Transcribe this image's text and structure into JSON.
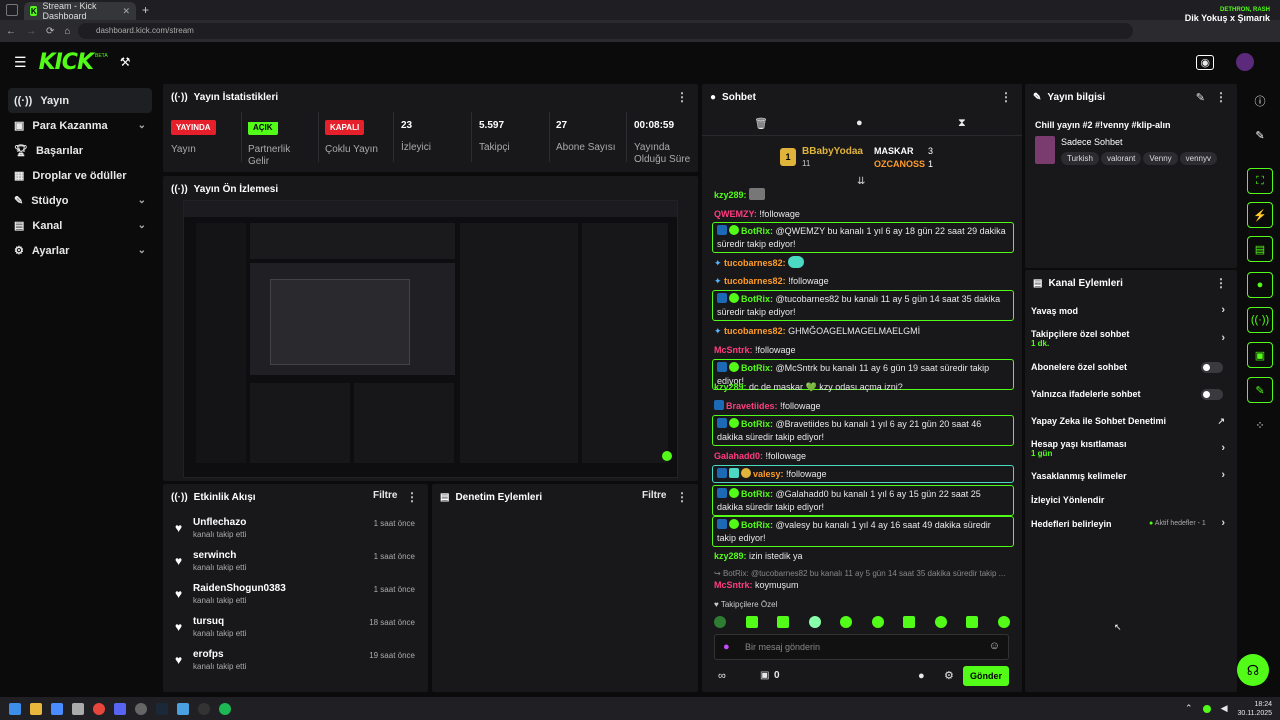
{
  "browser": {
    "tab_title": "Stream - Kick Dashboard",
    "new_tab": "+",
    "url": "dashboard.kick.com/stream",
    "now_playing_artist": "DETHRON, RASH",
    "now_playing_title": "Dik Yokuş x Şımarık"
  },
  "header": {
    "logo": "KICK",
    "beta": "BETA"
  },
  "sidebar": {
    "items": [
      {
        "label": "Yayın",
        "icon": "broadcast-icon",
        "active": true
      },
      {
        "label": "Para Kazanma",
        "icon": "money-icon",
        "chevron": true
      },
      {
        "label": "Başarılar",
        "icon": "trophy-icon"
      },
      {
        "label": "Droplar ve ödüller",
        "icon": "gift-icon"
      },
      {
        "label": "Stüdyo",
        "icon": "studio-icon",
        "chevron": true
      },
      {
        "label": "Kanal",
        "icon": "channel-icon",
        "chevron": true
      },
      {
        "label": "Ayarlar",
        "icon": "gear-icon",
        "chevron": true
      }
    ]
  },
  "stats": {
    "title": "Yayın İstatistikleri",
    "items": [
      {
        "value": "YAYINDA",
        "label": "Yayın",
        "type": "badge-red"
      },
      {
        "value": "AÇIK",
        "label": "Partnerlik Gelir Programı",
        "type": "badge-green"
      },
      {
        "value": "KAPALI",
        "label": "Çoklu Yayın",
        "type": "badge-red"
      },
      {
        "value": "23",
        "label": "İzleyici"
      },
      {
        "value": "5.597",
        "label": "Takipçi"
      },
      {
        "value": "27",
        "label": "Abone Sayısı"
      },
      {
        "value": "00:08:59",
        "label": "Yayında Olduğu Süre"
      }
    ]
  },
  "preview": {
    "title": "Yayın Ön İzlemesi"
  },
  "activity": {
    "title": "Etkinlik Akışı",
    "filter": "Filtre",
    "events": [
      {
        "name": "Unflechazo",
        "sub": "kanalı takip etti",
        "time": "1 saat önce"
      },
      {
        "name": "serwinch",
        "sub": "kanalı takip etti",
        "time": "1 saat önce"
      },
      {
        "name": "RaidenShogun0383",
        "sub": "kanalı takip etti",
        "time": "1 saat önce"
      },
      {
        "name": "tursuq",
        "sub": "kanalı takip etti",
        "time": "18 saat önce"
      },
      {
        "name": "erofps",
        "sub": "kanalı takip etti",
        "time": "19 saat önce"
      }
    ]
  },
  "moderation": {
    "title": "Denetim Eylemleri",
    "filter": "Filtre"
  },
  "chat": {
    "title": "Sohbet",
    "leaderboard": {
      "first": {
        "name": "BBabyYodaa",
        "count": "11"
      },
      "second": {
        "name": "MASKAR",
        "count": "3"
      },
      "third": {
        "name": "OZCANOSS",
        "count": "1"
      }
    },
    "messages": [
      {
        "user": "kzy289",
        "text": "",
        "color": "green",
        "type": "msg"
      },
      {
        "user": "QWEMZY",
        "text": "!followage",
        "color": "pink",
        "type": "msg"
      },
      {
        "user": "BotRix",
        "text": "@QWEMZY bu kanalı 1 yıl 6 ay 18 gün 22 saat 29 dakika süredir takip ediyor!",
        "type": "bot"
      },
      {
        "user": "tucobarnes82",
        "text": "",
        "color": "orange",
        "type": "msg"
      },
      {
        "user": "tucobarnes82",
        "text": "!followage",
        "color": "orange",
        "type": "msg"
      },
      {
        "user": "BotRix",
        "text": "@tucobarnes82 bu kanalı 11 ay 5 gün 14 saat 35 dakika süredir takip ediyor!",
        "type": "bot"
      },
      {
        "user": "tucobarnes82",
        "text": "GHMĞOAGELMAGELMAELGMİ",
        "color": "orange",
        "type": "msg"
      },
      {
        "user": "McSntrk",
        "text": "!followage",
        "color": "pink",
        "type": "msg"
      },
      {
        "user": "BotRix",
        "text": "@McSntrk bu kanalı 11 ay 6 gün 19 saat süredir takip ediyor!",
        "type": "bot"
      },
      {
        "user": "kzy289",
        "text": "dc de maskar 💚 kzy odası açma izni?",
        "color": "green",
        "type": "msg"
      },
      {
        "user": "Bravetiides",
        "text": "!followage",
        "color": "pink",
        "type": "msg"
      },
      {
        "user": "BotRix",
        "text": "@Bravetiides bu kanalı 1 yıl 6 ay 21 gün 20 saat 46 dakika süredir takip ediyor!",
        "type": "bot"
      },
      {
        "user": "Galahadd0",
        "text": "!followage",
        "color": "pink",
        "type": "msg"
      },
      {
        "user": "valesy",
        "text": "!followage",
        "color": "orange",
        "type": "highlight"
      },
      {
        "user": "BotRix",
        "text": "@Galahadd0 bu kanalı 1 yıl 6 ay 15 gün 22 saat 25 dakika süredir takip ediyor!",
        "type": "bot"
      },
      {
        "user": "BotRix",
        "text": "@valesy bu kanalı 1 yıl 4 ay 16 saat 49 dakika süredir takip ediyor!",
        "type": "bot"
      },
      {
        "user": "kzy289",
        "text": "izin istedik ya",
        "color": "green",
        "type": "msg"
      }
    ],
    "reply_preview": "BotRix: @tucobarnes82 bu kanalı 11 ay 5 gün 14 saat 35 dakika süredir takip ...",
    "reply_user": "McSntrk",
    "reply_text": "koymuşum",
    "followers_only_label": "Takipçilere Özel",
    "input_placeholder": "Bir mesaj gönderin",
    "points": "0",
    "send": "Gönder"
  },
  "stream_info": {
    "title": "Yayın bilgisi",
    "stream_title": "Chill yayın #2 #!venny #klip-alın",
    "category": "Sadece Sohbet",
    "tags": [
      "Turkish",
      "valorant",
      "Venny",
      "vennyv"
    ]
  },
  "channel_actions": {
    "title": "Kanal Eylemleri",
    "items": [
      {
        "label": "Yavaş mod",
        "control": "arrow"
      },
      {
        "label": "Takipçilere özel sohbet",
        "sub": "1 dk.",
        "control": "arrow"
      },
      {
        "label": "Abonelere özel sohbet",
        "control": "toggle"
      },
      {
        "label": "Yalnızca ifadelerle sohbet",
        "control": "toggle"
      },
      {
        "label": "Yapay Zeka ile Sohbet Denetimi",
        "control": "external"
      },
      {
        "label": "Hesap yaşı kısıtlaması",
        "sub": "1 gün",
        "control": "arrow"
      },
      {
        "label": "Yasaklanmış kelimeler",
        "control": "arrow"
      },
      {
        "label": "İzleyici Yönlendir",
        "control": "none"
      },
      {
        "label": "Hedefleri belirleyin",
        "control": "arrow",
        "note": "Aktif hedefler - 1"
      }
    ]
  },
  "taskbar": {
    "time": "18:24",
    "date": "30.11.2025"
  },
  "colors": {
    "accent": "#53fc18",
    "danger": "#e5202b",
    "panel": "#18181b"
  }
}
